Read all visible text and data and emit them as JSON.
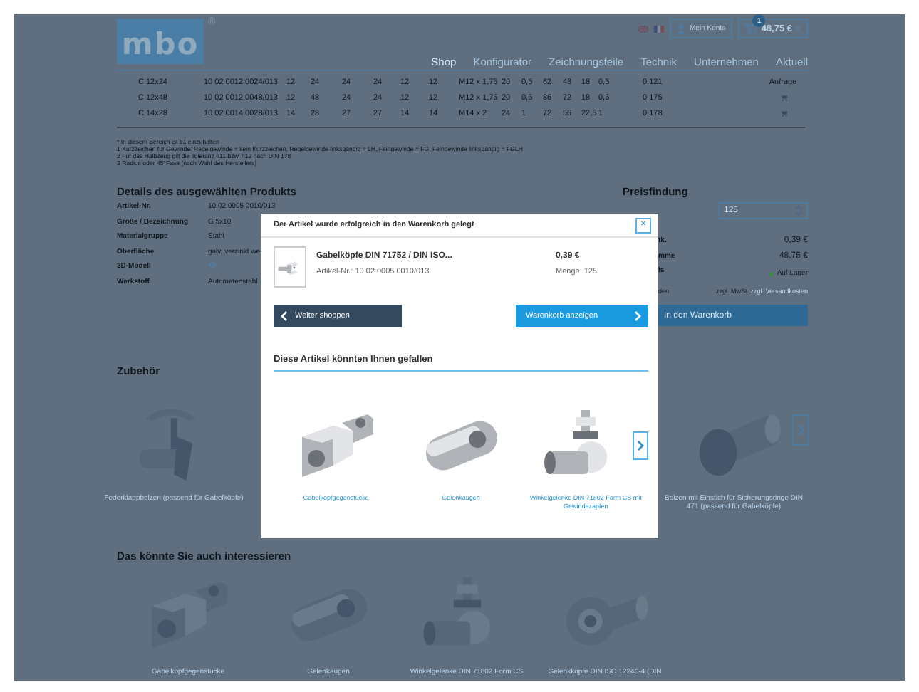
{
  "header": {
    "logo": "mbo",
    "registered": "®",
    "account": "Mein Konto",
    "cart_count": "1",
    "cart_total": "48,75 €",
    "nav": [
      {
        "label": "Shop",
        "selected": true
      },
      {
        "label": "Konfigurator",
        "selected": false
      },
      {
        "label": "Zeichnungsteile",
        "selected": false
      },
      {
        "label": "Technik",
        "selected": false
      },
      {
        "label": "Unternehmen",
        "selected": false
      },
      {
        "label": "Aktuell",
        "selected": false
      }
    ]
  },
  "spec_table": {
    "rows": [
      {
        "cells": [
          "C 12x24",
          "10 02 0012 0024/013",
          "12",
          "24",
          "24",
          "24",
          "12",
          "12",
          "M12 x 1,75",
          "20",
          "0,5",
          "62",
          "48",
          "18",
          "0,5",
          "0,121"
        ],
        "action": {
          "kind": "text",
          "label": "Anfrage"
        }
      },
      {
        "cells": [
          "C 12x48",
          "10 02 0012 0048/013",
          "12",
          "48",
          "24",
          "24",
          "12",
          "12",
          "M12 x 1,75",
          "20",
          "0,5",
          "86",
          "72",
          "18",
          "0,5",
          "0,175"
        ],
        "action": {
          "kind": "cart"
        }
      },
      {
        "cells": [
          "C 14x28",
          "10 02 0014 0028/013",
          "14",
          "28",
          "27",
          "27",
          "14",
          "14",
          "M14 x 2",
          "24",
          "1",
          "72",
          "56",
          "22,5",
          "1",
          "0,178"
        ],
        "action": {
          "kind": "cart"
        }
      }
    ]
  },
  "footnotes": [
    "* In diesem Bereich ist b1 einzuhalten",
    "1 Kurzzeichen für Gewinde: Regelgewinde = kein Kurzzeichen, Regelgewinde linksgängig = LH, Feingewinde = FG, Feingewinde linksgängig = FGLH",
    "2 Für das Halbzeug gilt die Toleranz h11 bzw. h12 nach DIN 178",
    "3 Radius oder 45°Fase (nach Wahl des Herstellers)"
  ],
  "details": {
    "title": "Details des ausgewählten Produkts",
    "rows": [
      {
        "kind": "text",
        "label": "Artikel-Nr.",
        "value": "10 02 0005 0010/013"
      },
      {
        "kind": "text",
        "label": "Größe / Bezeichnung",
        "value": "G 5x10"
      },
      {
        "kind": "text",
        "label": "Materialgruppe",
        "value": "Stahl"
      },
      {
        "kind": "text",
        "label": "Oberfläche",
        "value": "galv. verzinkt we"
      },
      {
        "kind": "eye",
        "label": "3D-Modell"
      },
      {
        "kind": "text",
        "label": "Werkstoff",
        "value": "Automatenstahl"
      }
    ]
  },
  "pricing": {
    "title": "Preisfindung",
    "quantity": "125",
    "rows": [
      {
        "kind": "text",
        "label": "tk.",
        "value": "0,39 €"
      },
      {
        "kind": "text",
        "label": "mme",
        "value": "48,75 €"
      },
      {
        "kind": "stock",
        "label": "ls",
        "value": "Auf Lager"
      }
    ],
    "tax_label": "den",
    "tax_note": "zzgl. MwSt.",
    "shipping_link": "zzgl. Versandkosten",
    "add_button": "In den Warenkorb"
  },
  "accessories": {
    "title": "Zubehör",
    "items": [
      {
        "kind": "spring-pin",
        "caption": "Federklappbolzen (passend für Gabelköpfe)"
      },
      {
        "kind": "pin",
        "caption": "Bolzen mit Einstich für Sicherungsringe DIN 471 (passend für Gabelköpfe)"
      }
    ]
  },
  "suggestions": {
    "title": "Das könnte Sie auch interessieren",
    "items": [
      {
        "kind": "fork",
        "caption": "Gabelkopfgegenstücke"
      },
      {
        "kind": "eye",
        "caption": "Gelenkaugen"
      },
      {
        "kind": "angle",
        "caption": "Winkelgelenke DIN 71802 Form CS"
      },
      {
        "kind": "rodend",
        "caption": "Gelenkköpfe DIN ISO 12240-4 (DIN"
      }
    ]
  },
  "modal": {
    "title": "Der Artikel wurde erfolgreich in den Warenkorb gelegt",
    "close": "×",
    "product": {
      "name": "Gabelköpfe DIN 71752 / DIN ISO...",
      "article": "Artikel-Nr.: 10 02 0005 0010/013",
      "price": "0,39 €",
      "quantity": "Menge: 125"
    },
    "continue_button": "Weiter shoppen",
    "cart_button": "Warenkorb anzeigen",
    "recommend_title": "Diese Artikel könnten Ihnen gefallen",
    "items": [
      {
        "kind": "fork",
        "caption": "Gabelkopfgegenstücke"
      },
      {
        "kind": "eye",
        "caption": "Gelenkaugen"
      },
      {
        "kind": "angle",
        "caption": "Winkelgelenke DIN 71802 Form CS mit Gewindezapfen"
      }
    ]
  }
}
